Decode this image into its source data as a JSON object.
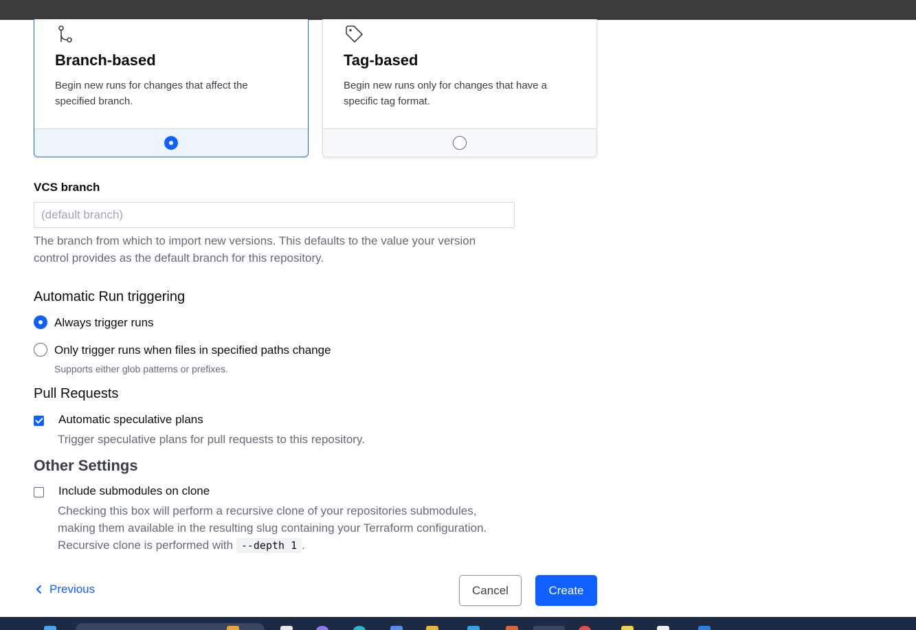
{
  "trigger_cards": [
    {
      "title": "Branch-based",
      "description": "Begin new runs for changes that affect the specified branch.",
      "icon": "git-branch-icon",
      "selected": true
    },
    {
      "title": "Tag-based",
      "description": "Begin new runs only for changes that have a specific tag format.",
      "icon": "tag-icon",
      "selected": false
    }
  ],
  "vcs_branch": {
    "label": "VCS branch",
    "placeholder": "(default branch)",
    "value": "",
    "help": "The branch from which to import new versions. This defaults to the value your version control provides as the default branch for this repository."
  },
  "automatic_run": {
    "heading": "Automatic Run triggering",
    "options": [
      {
        "label": "Always trigger runs",
        "selected": true
      },
      {
        "label": "Only trigger runs when files in specified paths change",
        "help": "Supports either glob patterns or prefixes.",
        "selected": false
      }
    ]
  },
  "pull_requests": {
    "heading": "Pull Requests",
    "checkbox_label": "Automatic speculative plans",
    "checked": true,
    "help": "Trigger speculative plans for pull requests to this repository."
  },
  "other_settings": {
    "heading": "Other Settings",
    "checkbox_label": "Include submodules on clone",
    "checked": false,
    "help_line1": "Checking this box will perform a recursive clone of your repositories submodules,",
    "help_line2": "making them available in the resulting slug containing your Terraform configuration.",
    "help_line3_prefix": "Recursive clone is performed with",
    "help_code": "--depth 1",
    "help_line3_suffix": "."
  },
  "footer": {
    "previous_label": "Previous",
    "cancel_label": "Cancel",
    "create_label": "Create"
  },
  "colors": {
    "primary": "#1060ff",
    "text": "#0c0c0e",
    "muted": "#656a76"
  }
}
